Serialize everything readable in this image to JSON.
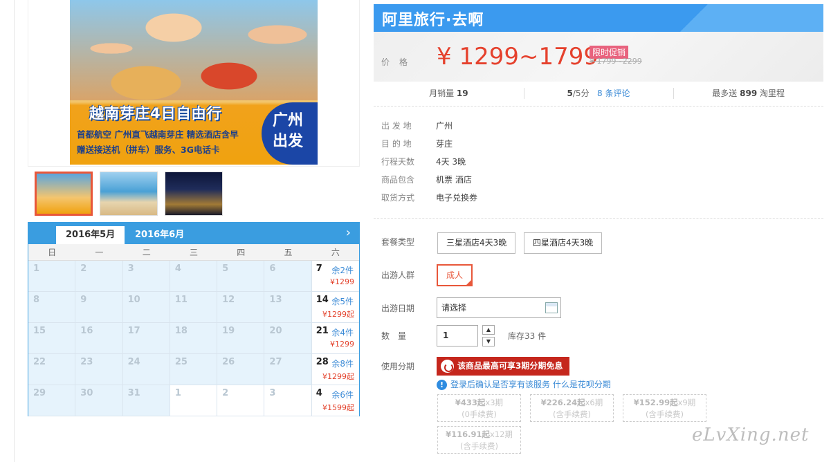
{
  "hero": {
    "title": "越南芽庄4日自由行",
    "sub_line1": "首都航空  广州直飞越南芽庄  精选酒店含早",
    "sub_line2": "赠送接送机（拼车）服务、3G电话卡",
    "badge_line1": "广州",
    "badge_line2": "出发"
  },
  "calendar": {
    "tabs": [
      "2016年5月",
      "2016年6月"
    ],
    "next_icon": "chevron-right-icon",
    "weekdays": [
      "日",
      "一",
      "二",
      "三",
      "四",
      "五",
      "六"
    ],
    "cells": [
      {
        "day": "1"
      },
      {
        "day": "2"
      },
      {
        "day": "3"
      },
      {
        "day": "4"
      },
      {
        "day": "5"
      },
      {
        "day": "6"
      },
      {
        "day": "7",
        "stock": "余2件",
        "price": "¥1299"
      },
      {
        "day": "8"
      },
      {
        "day": "9"
      },
      {
        "day": "10"
      },
      {
        "day": "11"
      },
      {
        "day": "12"
      },
      {
        "day": "13"
      },
      {
        "day": "14",
        "stock": "余5件",
        "price": "¥1299起"
      },
      {
        "day": "15"
      },
      {
        "day": "16"
      },
      {
        "day": "17"
      },
      {
        "day": "18"
      },
      {
        "day": "19"
      },
      {
        "day": "20"
      },
      {
        "day": "21",
        "stock": "余4件",
        "price": "¥1299"
      },
      {
        "day": "22"
      },
      {
        "day": "23"
      },
      {
        "day": "24"
      },
      {
        "day": "25"
      },
      {
        "day": "26"
      },
      {
        "day": "27"
      },
      {
        "day": "28",
        "stock": "余8件",
        "price": "¥1299起"
      },
      {
        "day": "29"
      },
      {
        "day": "30"
      },
      {
        "day": "31"
      },
      {
        "day": "1",
        "blank": true
      },
      {
        "day": "2",
        "blank": true
      },
      {
        "day": "3",
        "blank": true
      },
      {
        "day": "4",
        "stock": "余6件",
        "price": "¥1599起"
      }
    ]
  },
  "brand": {
    "name": "阿里旅行·去啊"
  },
  "price": {
    "label": "价格",
    "range": "¥ 1299~1799",
    "promo": "限时促销",
    "original": "¥ 1799~2299"
  },
  "stats": {
    "sales_label": "月销量",
    "sales_value": "19",
    "rating_value": "5",
    "rating_suffix": "/5分",
    "reviews": "8 条评论",
    "miles_prefix": "最多送",
    "miles_value": "899",
    "miles_suffix": "淘里程"
  },
  "info": [
    {
      "k": "出 发 地",
      "v": "广州"
    },
    {
      "k": "目 的 地",
      "v": "芽庄"
    },
    {
      "k": "行程天数",
      "v": "4天 3晚"
    },
    {
      "k": "商品包含",
      "v": "机票  酒店"
    },
    {
      "k": "取货方式",
      "v": "电子兑换券"
    }
  ],
  "options": {
    "package_label": "套餐类型",
    "packages": [
      "三星酒店4天3晚",
      "四星酒店4天3晚"
    ],
    "people_label": "出游人群",
    "people_value": "成人",
    "date_label": "出游日期",
    "date_placeholder": "请选择",
    "qty_label": "数　量",
    "qty_value": "1",
    "stock_text": "库存33 件",
    "installment_label": "使用分期",
    "huabei_text": "该商品最高可享3期分期免息",
    "notice_text": "登录后确认是否享有该服务",
    "notice_link": "什么是花呗分期",
    "plans": [
      {
        "amount": "¥433起",
        "term": "x3期",
        "fee": "(0手续费)"
      },
      {
        "amount": "¥226.24起",
        "term": "x6期",
        "fee": "(含手续费)"
      },
      {
        "amount": "¥152.99起",
        "term": "x9期",
        "fee": "(含手续费)"
      },
      {
        "amount": "¥116.91起",
        "term": "x12期",
        "fee": "(含手续费)"
      }
    ]
  },
  "watermark": "eLvXing.net"
}
